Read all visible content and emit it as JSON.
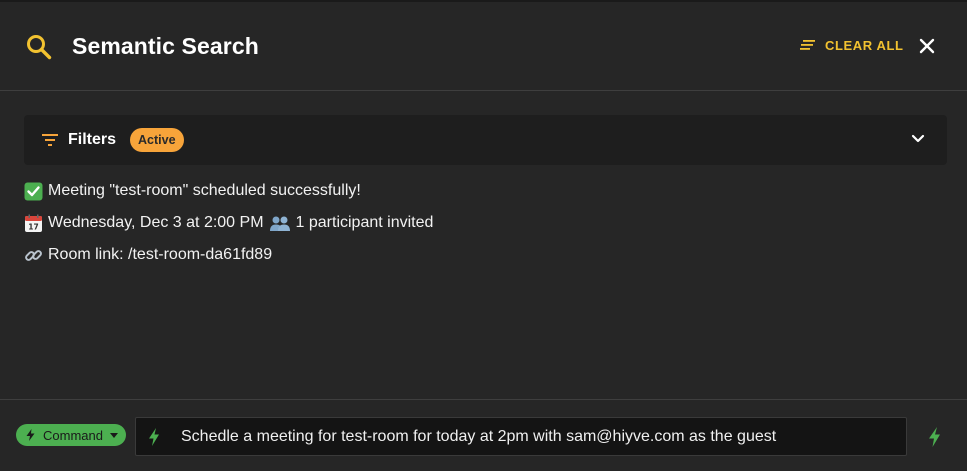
{
  "header": {
    "title": "Semantic Search",
    "clear_all_label": "CLEAR ALL"
  },
  "filters": {
    "label": "Filters",
    "badge": "Active"
  },
  "messages": [
    {
      "icon": "check-mark-emoji",
      "text": "Meeting \"test-room\" scheduled successfully!"
    },
    {
      "icon": "calendar-emoji",
      "text": "Wednesday, Dec 3 at 2:00 PM",
      "icon2": "participants-emoji",
      "text2": "1 participant invited"
    },
    {
      "icon": "link-emoji",
      "text": "Room link: /test-room-da61fd89"
    }
  ],
  "footer": {
    "mode_label": "Command",
    "input_value": "Schedle a meeting for test-room for today at 2pm with sam@hiyve.com as the guest"
  },
  "colors": {
    "accent_yellow": "#f2c230",
    "badge_orange": "#f7a43a",
    "command_green": "#4caf50",
    "background": "#262626"
  }
}
